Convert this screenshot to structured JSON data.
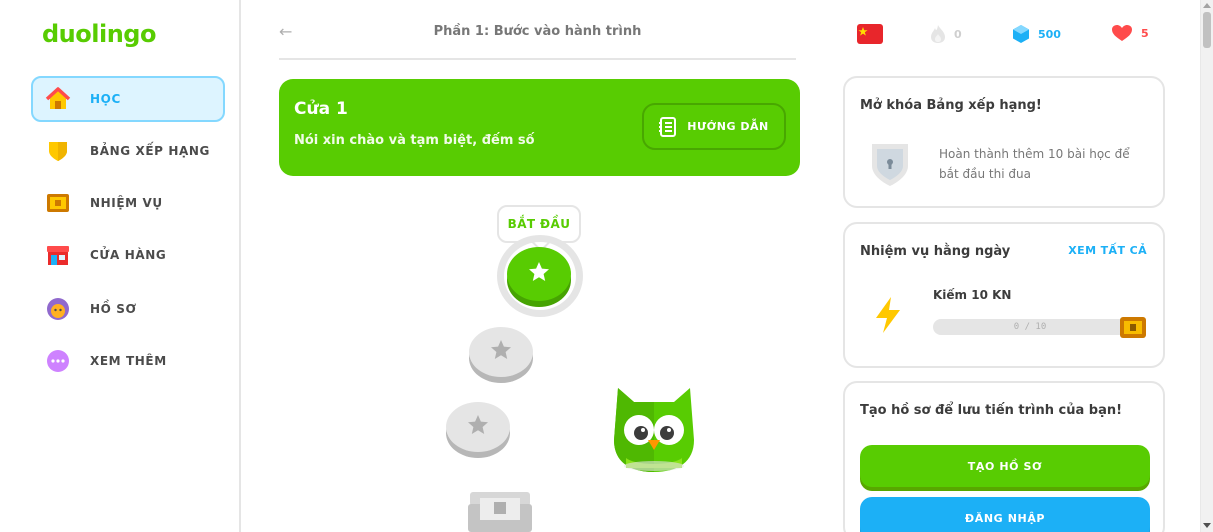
{
  "app": {
    "logo": "duolingo"
  },
  "sidebar": {
    "items": [
      {
        "label": "HỌC",
        "icon": "home-icon",
        "active": true
      },
      {
        "label": "BẢNG XẾP HẠNG",
        "icon": "shield-icon",
        "active": false
      },
      {
        "label": "NHIỆM VỤ",
        "icon": "chest-icon",
        "active": false
      },
      {
        "label": "CỬA HÀNG",
        "icon": "shop-icon",
        "active": false
      },
      {
        "label": "HỒ SƠ",
        "icon": "profile-icon",
        "active": false
      },
      {
        "label": "XEM THÊM",
        "icon": "more-icon",
        "active": false
      }
    ]
  },
  "header": {
    "back_icon": "←",
    "section_title": "Phần 1: Bước vào hành trình"
  },
  "unit": {
    "title": "Cửa 1",
    "description": "Nói xin chào và tạm biệt, đếm số",
    "guide_label": "HƯỚNG DẪN"
  },
  "path": {
    "start_label": "BẮT ĐẦU"
  },
  "stats": {
    "language": "flag-china-icon",
    "streak": "0",
    "gems": "500",
    "hearts": "5"
  },
  "leaderboard_panel": {
    "title": "Mở khóa Bảng xếp hạng!",
    "text": "Hoàn thành thêm 10 bài học để bắt đầu thi đua"
  },
  "quests_panel": {
    "title": "Nhiệm vụ hằng ngày",
    "view_all": "XEM TẤT CẢ",
    "quest_name": "Kiếm 10 KN",
    "progress_text": "0 / 10",
    "progress": 0
  },
  "profile_panel": {
    "title": "Tạo hồ sơ để lưu tiến trình của bạn!",
    "create_label": "TẠO HỒ SƠ",
    "login_label": "ĐĂNG NHẬP"
  },
  "colors": {
    "brand": "#58cc02",
    "accent": "#1cb0f6",
    "heart": "#ff4b4b",
    "gem": "#1cb0f6"
  }
}
